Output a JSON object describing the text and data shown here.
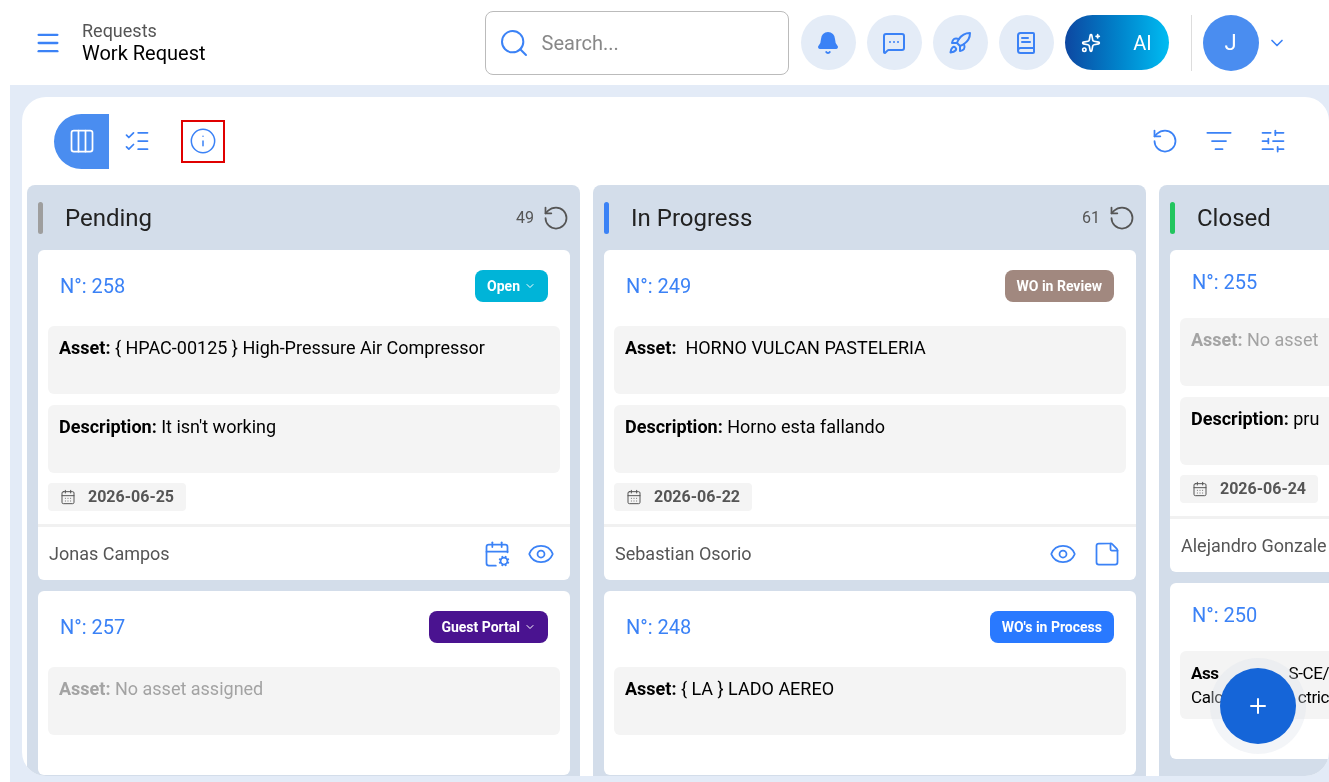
{
  "header": {
    "breadcrumb": "Requests",
    "title": "Work Request",
    "search": {
      "placeholder": "Search..."
    },
    "ai_button": "AI",
    "avatar": "J"
  },
  "toolbar": {
    "views": [
      {
        "kind": "board",
        "selected": true
      },
      {
        "kind": "list",
        "selected": false
      }
    ],
    "info_highlighted": true
  },
  "columns": [
    {
      "title": "Pending",
      "color": "#9e9e9e",
      "count": "49",
      "cards": [
        {
          "number": "N°: 258",
          "status": {
            "label": "Open",
            "color": "#00b4d8",
            "dropdown": true
          },
          "asset_label": "Asset:",
          "asset": "{ HPAC-00125 } High-Pressure Air Compressor",
          "asset_assigned": true,
          "description_label": "Description:",
          "description": "It isn't working",
          "date": "2026-06-25",
          "requester": "Jonas Campos",
          "actions": [
            {
              "kind": "schedule"
            },
            {
              "kind": "view"
            }
          ]
        },
        {
          "number": "N°: 257",
          "status": {
            "label": "Guest Portal",
            "color": "#4a1390",
            "dropdown": true
          },
          "asset_label": "Asset:",
          "asset": "No asset assigned",
          "asset_assigned": false
        }
      ]
    },
    {
      "title": "In Progress",
      "color": "#3b82f6",
      "count": "61",
      "cards": [
        {
          "number": "N°: 249",
          "status": {
            "label": "WO in Review",
            "color": "#a1887f",
            "dropdown": false
          },
          "asset_label": "Asset:",
          "asset": " HORNO VULCAN PASTELERIA",
          "asset_assigned": true,
          "description_label": "Description:",
          "description": "Horno esta fallando",
          "date": "2026-06-22",
          "requester": "Sebastian Osorio",
          "actions": [
            {
              "kind": "view"
            },
            {
              "kind": "notes"
            }
          ]
        },
        {
          "number": "N°: 248",
          "status": {
            "label": "WO's in Process",
            "color": "#2979ff",
            "dropdown": false
          },
          "asset_label": "Asset:",
          "asset": "{ LA } LADO AEREO",
          "asset_assigned": true
        }
      ]
    },
    {
      "title": "Closed",
      "color": "#22c55e",
      "cards": [
        {
          "number": "N°: 255",
          "asset_label": "Asset:",
          "asset": "No asset",
          "asset_assigned": false,
          "description_label": "Description:",
          "description": "pru",
          "date": "2026-06-24",
          "requester": "Alejandro Gonzale"
        },
        {
          "number": "N°: 250",
          "asset_fragments": [
            [
              "Ass",
              "S-CE/"
            ],
            [
              "Calc",
              "ctric"
            ]
          ],
          "asset_assigned": true
        }
      ]
    }
  ]
}
